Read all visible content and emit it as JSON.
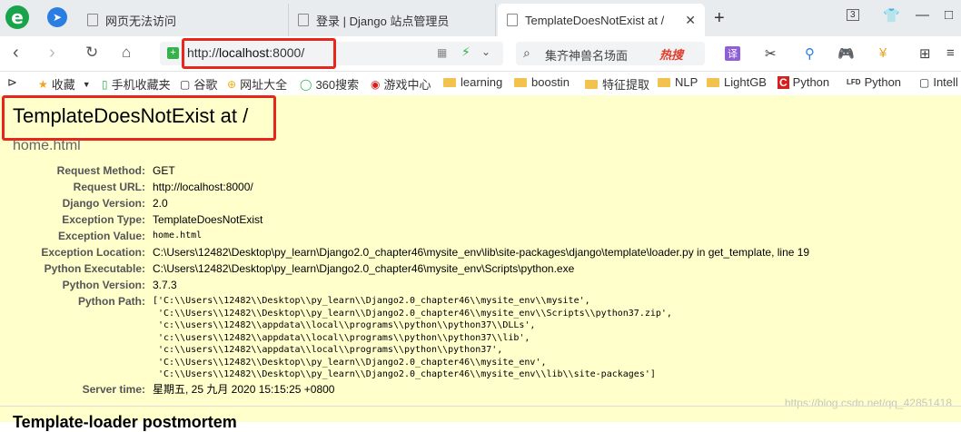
{
  "browser": {
    "tabs": [
      {
        "label": "网页无法访问"
      },
      {
        "label": "登录 | Django 站点管理员"
      },
      {
        "label": "TemplateDoesNotExist at /"
      }
    ],
    "address": {
      "url_prefix": "http://",
      "url_host": "localhost",
      "url_rest": ":8000/"
    },
    "search": {
      "query": "集齐神兽名场面",
      "hot_label": "热搜"
    },
    "window_badge": "3"
  },
  "bookmarks": [
    {
      "label": "收藏",
      "icon": "star-icon"
    },
    {
      "label": "手机收藏夹",
      "icon": "phone-icon"
    },
    {
      "label": "谷歌",
      "icon": "page-icon"
    },
    {
      "label": "网址大全",
      "icon": "plus-circle-icon"
    },
    {
      "label": "360搜索",
      "icon": "circle-icon"
    },
    {
      "label": "游戏中心",
      "icon": "game-icon"
    },
    {
      "label": "learning",
      "icon": "folder-icon"
    },
    {
      "label": "boostin",
      "icon": "folder-icon"
    },
    {
      "label": "特征提取",
      "icon": "folder-icon"
    },
    {
      "label": "NLP",
      "icon": "folder-icon"
    },
    {
      "label": "LightGB",
      "icon": "folder-icon"
    },
    {
      "label": "Python",
      "icon": "c-icon"
    },
    {
      "label": "Python",
      "icon": "lfd-icon"
    },
    {
      "label": "Intell",
      "icon": "page-icon"
    }
  ],
  "error": {
    "title": "TemplateDoesNotExist at /",
    "subtitle": "home.html",
    "rows": [
      {
        "key": "Request Method:",
        "value": "GET"
      },
      {
        "key": "Request URL:",
        "value": "http://localhost:8000/"
      },
      {
        "key": "Django Version:",
        "value": "2.0"
      },
      {
        "key": "Exception Type:",
        "value": "TemplateDoesNotExist"
      },
      {
        "key": "Exception Value:",
        "value": "home.html"
      },
      {
        "key": "Exception Location:",
        "value": "C:\\Users\\12482\\Desktop\\py_learn\\Django2.0_chapter46\\mysite_env\\lib\\site-packages\\django\\template\\loader.py in get_template, line 19"
      },
      {
        "key": "Python Executable:",
        "value": "C:\\Users\\12482\\Desktop\\py_learn\\Django2.0_chapter46\\mysite_env\\Scripts\\python.exe"
      },
      {
        "key": "Python Version:",
        "value": "3.7.3"
      },
      {
        "key": "Python Path:",
        "value": "['C:\\\\Users\\\\12482\\\\Desktop\\\\py_learn\\\\Django2.0_chapter46\\\\mysite_env\\\\mysite',\n 'C:\\\\Users\\\\12482\\\\Desktop\\\\py_learn\\\\Django2.0_chapter46\\\\mysite_env\\\\Scripts\\\\python37.zip',\n 'c:\\\\users\\\\12482\\\\appdata\\\\local\\\\programs\\\\python\\\\python37\\\\DLLs',\n 'c:\\\\users\\\\12482\\\\appdata\\\\local\\\\programs\\\\python\\\\python37\\\\lib',\n 'c:\\\\users\\\\12482\\\\appdata\\\\local\\\\programs\\\\python\\\\python37',\n 'C:\\\\Users\\\\12482\\\\Desktop\\\\py_learn\\\\Django2.0_chapter46\\\\mysite_env',\n 'C:\\\\Users\\\\12482\\\\Desktop\\\\py_learn\\\\Django2.0_chapter46\\\\mysite_env\\\\lib\\\\site-packages']"
      },
      {
        "key": "Server time:",
        "value": "星期五, 25 九月 2020 15:15:25 +0800"
      }
    ],
    "next_heading": "Template-loader postmortem"
  },
  "watermark": "https://blog.csdn.net/qq_42851418",
  "colors": {
    "highlight_box": "#e8261c",
    "error_bg": "#ffffcc",
    "tab_bar": "#e9ecef"
  }
}
